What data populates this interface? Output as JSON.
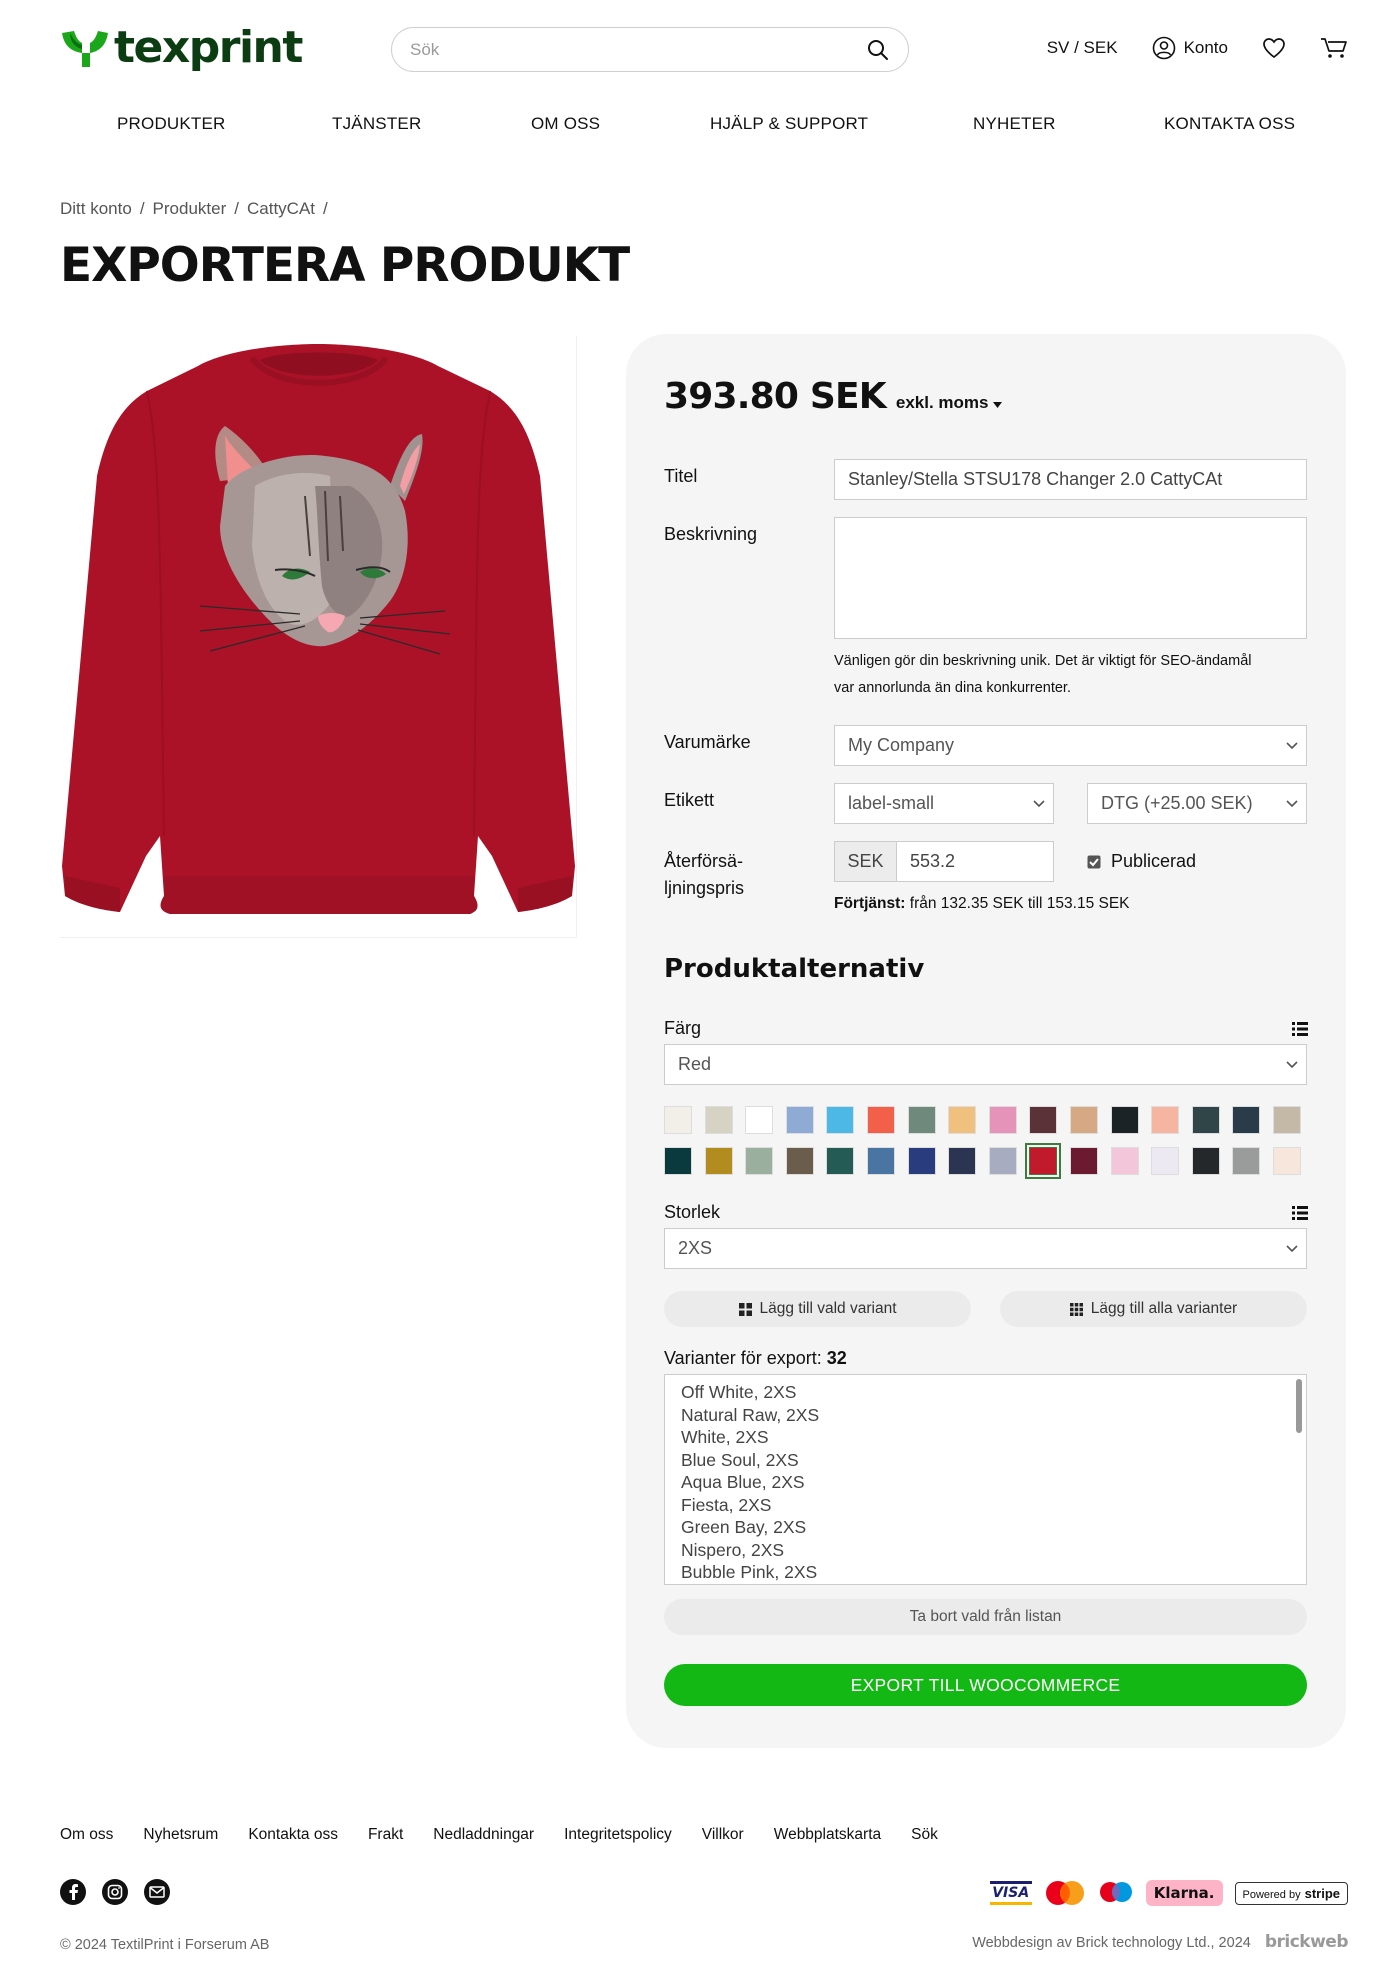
{
  "header": {
    "logo_text": "texprint",
    "search_placeholder": "Sök",
    "locale": "SV / SEK",
    "account_label": "Konto"
  },
  "nav": {
    "items": [
      {
        "label": "PRODUKTER"
      },
      {
        "label": "TJÄNSTER"
      },
      {
        "label": "OM OSS"
      },
      {
        "label": "HJÄLP & SUPPORT"
      },
      {
        "label": "NYHETER"
      },
      {
        "label": "KONTAKTA OSS"
      }
    ]
  },
  "breadcrumb": [
    "Ditt konto",
    "Produkter",
    "CattyCAt"
  ],
  "page_title": "EXPORTERA PRODUKT",
  "product": {
    "image_color": "#ab1228",
    "price": "393.80 SEK",
    "tax_label": "exkl. moms"
  },
  "form": {
    "title_label": "Titel",
    "title_value": "Stanley/Stella STSU178 Changer 2.0 CattyCAt",
    "description_label": "Beskrivning",
    "description_value": "",
    "description_hint_1": "Vänligen gör din beskrivning unik. Det är viktigt för SEO-ändamål",
    "description_hint_2": "var annorlunda än dina konkurrenter.",
    "brand_label": "Varumärke",
    "brand_value": "My Company",
    "label_label": "Etikett",
    "label_value": "label-small",
    "print_value": "DTG (+25.00 SEK)",
    "price_label_1": "Återförsä-",
    "price_label_2": "ljningspris",
    "currency": "SEK",
    "resale_price": "553.2",
    "published_label": "Publicerad",
    "published": true,
    "profit_label": "Förtjänst:",
    "profit_text": "från 132.35 SEK till 153.15 SEK"
  },
  "options": {
    "section_title": "Produktalternativ",
    "color_label": "Färg",
    "color_value": "Red",
    "swatches_row1": [
      "#f1efe8",
      "#d6d2c4",
      "#ffffff",
      "#8eabd6",
      "#4db8e6",
      "#f2604a",
      "#6f8a7d",
      "#f0c07f",
      "#e693ba",
      "#5a3237",
      "#d6a884",
      "#1c2326",
      "#f6b5a0",
      "#2f4548",
      "#2a3b49",
      "#c4b8a6"
    ],
    "swatches_row2": [
      "#0a3a3d",
      "#b38c1f",
      "#9aaf9d",
      "#6b5d4c",
      "#245c55",
      "#4a75a3",
      "#293c7e",
      "#2b3552",
      "#a7acc0",
      "#c11a2a",
      "#6b1a30",
      "#f4c6da",
      "#ede9f2",
      "#24282a",
      "#9a9b9b",
      "#f6e6dc"
    ],
    "selected_swatch_index": 9,
    "size_label": "Storlek",
    "size_value": "2XS",
    "add_selected_label": "Lägg till vald variant",
    "add_all_label": "Lägg till alla varianter",
    "variants_label": "Varianter för export:",
    "variants_count": "32",
    "variants": [
      "Off White, 2XS",
      "Natural Raw, 2XS",
      "White, 2XS",
      "Blue Soul, 2XS",
      "Aqua Blue, 2XS",
      "Fiesta, 2XS",
      "Green Bay, 2XS",
      "Nispero, 2XS",
      "Bubble Pink, 2XS"
    ],
    "remove_label": "Ta bort vald från listan",
    "export_label": "EXPORT TILL WOOCOMMERCE"
  },
  "footer": {
    "links": [
      "Om oss",
      "Nyhetsrum",
      "Kontakta oss",
      "Frakt",
      "Nedladdningar",
      "Integritetspolicy",
      "Villkor",
      "Webbplatskarta",
      "Sök"
    ],
    "visa": "VISA",
    "klarna": "Klarna.",
    "stripe_prefix": "Powered by",
    "stripe_brand": "stripe",
    "copyright": "© 2024 TextilPrint i Forserum AB",
    "credit": "Webbdesign av Brick technology Ltd., 2024",
    "credit_logo": "brickweb"
  }
}
